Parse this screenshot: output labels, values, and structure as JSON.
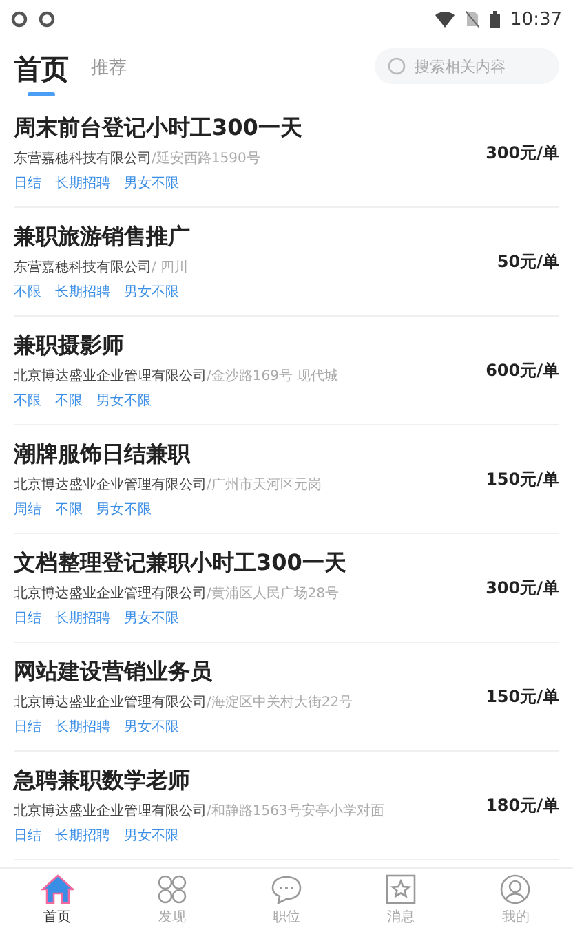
{
  "status_bar": {
    "time": "10:37"
  },
  "tabs": [
    {
      "label": "首页",
      "selected": true
    },
    {
      "label": "推荐",
      "selected": false
    }
  ],
  "search": {
    "placeholder": "搜索相关内容"
  },
  "jobs": [
    {
      "title": "周末前台登记小时工300一天",
      "company": "东营嘉穗科技有限公司",
      "location": "/延安西路1590号",
      "tags": [
        "日结",
        "长期招聘",
        "男女不限"
      ],
      "price": "300元/单"
    },
    {
      "title": "兼职旅游销售推广",
      "company": "东营嘉穗科技有限公司",
      "location": "/ 四川",
      "tags": [
        "不限",
        "长期招聘",
        "男女不限"
      ],
      "price": "50元/单"
    },
    {
      "title": "兼职摄影师",
      "company": "北京博达盛业企业管理有限公司",
      "location": "/金沙路169号 现代城",
      "tags": [
        "不限",
        "不限",
        "男女不限"
      ],
      "price": "600元/单"
    },
    {
      "title": "潮牌服饰日结兼职",
      "company": "北京博达盛业企业管理有限公司",
      "location": "/广州市天河区元岗",
      "tags": [
        "周结",
        "不限",
        "男女不限"
      ],
      "price": "150元/单"
    },
    {
      "title": "文档整理登记兼职小时工300一天",
      "company": "北京博达盛业企业管理有限公司",
      "location": "/黄浦区人民广场28号",
      "tags": [
        "日结",
        "长期招聘",
        "男女不限"
      ],
      "price": "300元/单"
    },
    {
      "title": "网站建设营销业务员",
      "company": "北京博达盛业企业管理有限公司",
      "location": "/海淀区中关村大街22号",
      "tags": [
        "日结",
        "长期招聘",
        "男女不限"
      ],
      "price": "150元/单"
    },
    {
      "title": "急聘兼职数学老师",
      "company": "北京博达盛业企业管理有限公司",
      "location": "/和静路1563号安亭小学对面",
      "tags": [
        "日结",
        "长期招聘",
        "男女不限"
      ],
      "price": "180元/单"
    }
  ],
  "nav": [
    {
      "kind": "home",
      "label": "首页",
      "selected": true
    },
    {
      "kind": "grid",
      "label": "发现",
      "selected": false
    },
    {
      "kind": "chat",
      "label": "职位",
      "selected": false
    },
    {
      "kind": "star",
      "label": "消息",
      "selected": false
    },
    {
      "kind": "user",
      "label": "我的",
      "selected": false
    }
  ]
}
